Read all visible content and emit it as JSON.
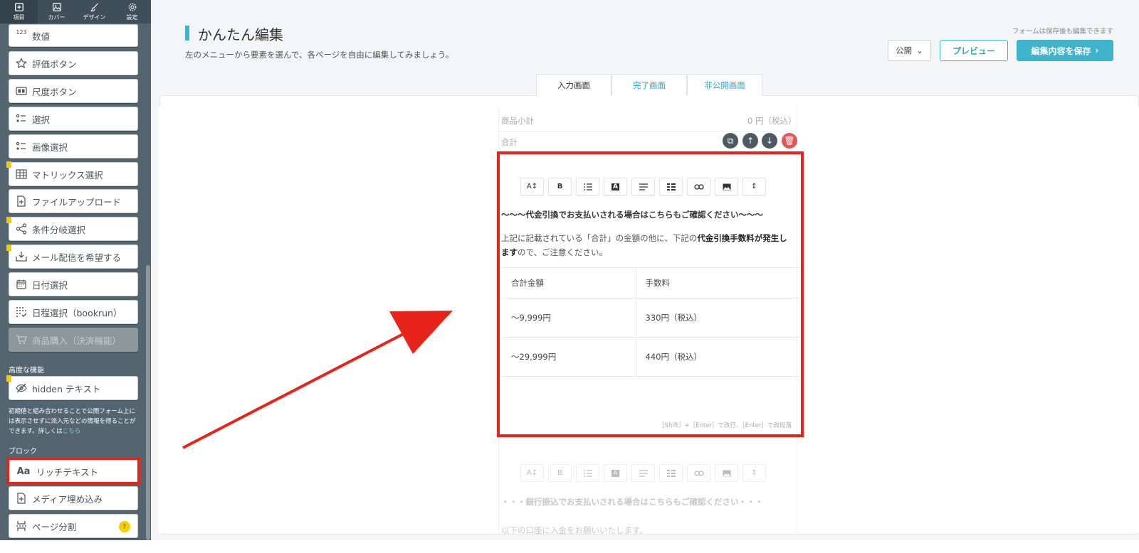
{
  "topnav": {
    "tabs": [
      {
        "label": "項目",
        "icon": "plus-square-icon"
      },
      {
        "label": "カバー",
        "icon": "image-icon"
      },
      {
        "label": "デザイン",
        "icon": "brush-icon"
      },
      {
        "label": "設定",
        "icon": "gear-icon"
      }
    ]
  },
  "sidebar": {
    "items": [
      {
        "label": "数値",
        "icon": "number-123-icon"
      },
      {
        "label": "評価ボタン",
        "icon": "star-icon"
      },
      {
        "label": "尺度ボタン",
        "icon": "scale-icon"
      },
      {
        "label": "選択",
        "icon": "list-select-icon"
      },
      {
        "label": "画像選択",
        "icon": "image-select-icon"
      },
      {
        "label": "マトリックス選択",
        "icon": "table-icon"
      },
      {
        "label": "ファイルアップロード",
        "icon": "file-upload-icon"
      },
      {
        "label": "条件分岐選択",
        "icon": "share-branch-icon"
      },
      {
        "label": "メール配信を希望する",
        "icon": "mail-download-icon"
      },
      {
        "label": "日付選択",
        "icon": "calendar-icon"
      },
      {
        "label": "日程選択（bookrun）",
        "icon": "schedule-dots-icon"
      },
      {
        "label": "商品購入（決済機能）",
        "icon": "cart-icon"
      }
    ],
    "advanced_heading": "高度な機能",
    "hidden_item": "hidden テキスト",
    "hidden_note": "初期値と組み合わせることで公開フォーム上には表示させずに流入元などの情報を得ることができます。詳しくは",
    "hidden_note_link": "こちら",
    "block_heading": "ブロック",
    "block_items": [
      {
        "label": "リッチテキスト",
        "icon": "text-aa-icon"
      },
      {
        "label": "メディア埋め込み",
        "icon": "media-embed-icon"
      },
      {
        "label": "ページ分割",
        "icon": "page-break-icon"
      }
    ]
  },
  "header": {
    "title": "かんたん編集",
    "subtitle": "左のメニューから要素を選んで、各ページを自由に編集してみましょう。",
    "save_note": "フォームは保存後も編集できます",
    "status_label": "公開",
    "preview_label": "プレビュー",
    "save_label": "編集内容を保存",
    "tabs": [
      "入力画面",
      "完了画面",
      "非公開画面"
    ]
  },
  "form": {
    "subtotal_label": "商品小計",
    "subtotal_value": "0 円（税込）",
    "total_label": "合計",
    "toolbar_buttons": [
      "A↕",
      "B",
      "list",
      "A",
      "align",
      "table",
      "link",
      "image",
      "divider"
    ],
    "rich_heading": "〜〜〜代金引換でお支払いされる場合はこちらもご確認ください〜〜〜",
    "rich_body_1": "上記に記載されている「合計」の金額の他に、下記の",
    "rich_body_bold": "代金引換手数料が発生します",
    "rich_body_2": "ので、ご注意ください。",
    "table": {
      "headers": [
        "合計金額",
        "手数料"
      ],
      "rows": [
        [
          "〜9,999円",
          "330円（税込）"
        ],
        [
          "〜29,999円",
          "440円（税込）"
        ]
      ]
    },
    "hint": "［Shift］+［Enter］で改行、［Enter］で改段落",
    "next_heading": "・・・銀行振込でお支払いされる場合はこちらもご確認ください・・・",
    "next_body": "以下の口座に入金をお願いいたします。"
  }
}
